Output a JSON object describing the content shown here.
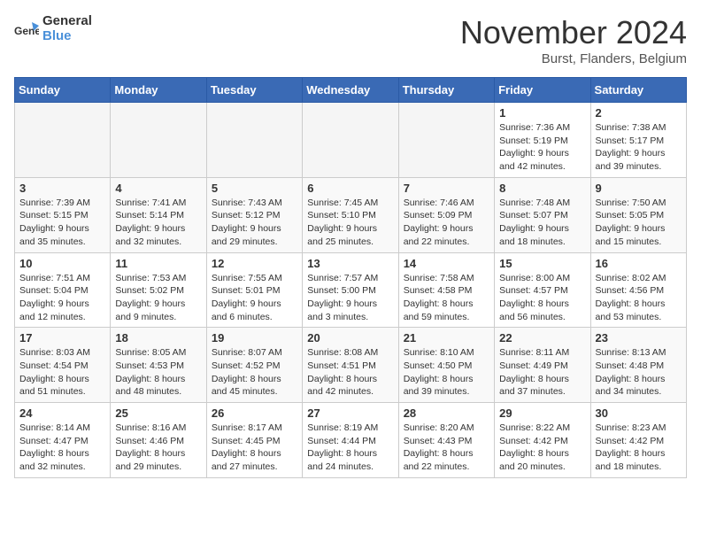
{
  "logo": {
    "line1": "General",
    "line2": "Blue"
  },
  "title": "November 2024",
  "location": "Burst, Flanders, Belgium",
  "days_of_week": [
    "Sunday",
    "Monday",
    "Tuesday",
    "Wednesday",
    "Thursday",
    "Friday",
    "Saturday"
  ],
  "weeks": [
    [
      {
        "day": "",
        "info": ""
      },
      {
        "day": "",
        "info": ""
      },
      {
        "day": "",
        "info": ""
      },
      {
        "day": "",
        "info": ""
      },
      {
        "day": "",
        "info": ""
      },
      {
        "day": "1",
        "info": "Sunrise: 7:36 AM\nSunset: 5:19 PM\nDaylight: 9 hours and 42 minutes."
      },
      {
        "day": "2",
        "info": "Sunrise: 7:38 AM\nSunset: 5:17 PM\nDaylight: 9 hours and 39 minutes."
      }
    ],
    [
      {
        "day": "3",
        "info": "Sunrise: 7:39 AM\nSunset: 5:15 PM\nDaylight: 9 hours and 35 minutes."
      },
      {
        "day": "4",
        "info": "Sunrise: 7:41 AM\nSunset: 5:14 PM\nDaylight: 9 hours and 32 minutes."
      },
      {
        "day": "5",
        "info": "Sunrise: 7:43 AM\nSunset: 5:12 PM\nDaylight: 9 hours and 29 minutes."
      },
      {
        "day": "6",
        "info": "Sunrise: 7:45 AM\nSunset: 5:10 PM\nDaylight: 9 hours and 25 minutes."
      },
      {
        "day": "7",
        "info": "Sunrise: 7:46 AM\nSunset: 5:09 PM\nDaylight: 9 hours and 22 minutes."
      },
      {
        "day": "8",
        "info": "Sunrise: 7:48 AM\nSunset: 5:07 PM\nDaylight: 9 hours and 18 minutes."
      },
      {
        "day": "9",
        "info": "Sunrise: 7:50 AM\nSunset: 5:05 PM\nDaylight: 9 hours and 15 minutes."
      }
    ],
    [
      {
        "day": "10",
        "info": "Sunrise: 7:51 AM\nSunset: 5:04 PM\nDaylight: 9 hours and 12 minutes."
      },
      {
        "day": "11",
        "info": "Sunrise: 7:53 AM\nSunset: 5:02 PM\nDaylight: 9 hours and 9 minutes."
      },
      {
        "day": "12",
        "info": "Sunrise: 7:55 AM\nSunset: 5:01 PM\nDaylight: 9 hours and 6 minutes."
      },
      {
        "day": "13",
        "info": "Sunrise: 7:57 AM\nSunset: 5:00 PM\nDaylight: 9 hours and 3 minutes."
      },
      {
        "day": "14",
        "info": "Sunrise: 7:58 AM\nSunset: 4:58 PM\nDaylight: 8 hours and 59 minutes."
      },
      {
        "day": "15",
        "info": "Sunrise: 8:00 AM\nSunset: 4:57 PM\nDaylight: 8 hours and 56 minutes."
      },
      {
        "day": "16",
        "info": "Sunrise: 8:02 AM\nSunset: 4:56 PM\nDaylight: 8 hours and 53 minutes."
      }
    ],
    [
      {
        "day": "17",
        "info": "Sunrise: 8:03 AM\nSunset: 4:54 PM\nDaylight: 8 hours and 51 minutes."
      },
      {
        "day": "18",
        "info": "Sunrise: 8:05 AM\nSunset: 4:53 PM\nDaylight: 8 hours and 48 minutes."
      },
      {
        "day": "19",
        "info": "Sunrise: 8:07 AM\nSunset: 4:52 PM\nDaylight: 8 hours and 45 minutes."
      },
      {
        "day": "20",
        "info": "Sunrise: 8:08 AM\nSunset: 4:51 PM\nDaylight: 8 hours and 42 minutes."
      },
      {
        "day": "21",
        "info": "Sunrise: 8:10 AM\nSunset: 4:50 PM\nDaylight: 8 hours and 39 minutes."
      },
      {
        "day": "22",
        "info": "Sunrise: 8:11 AM\nSunset: 4:49 PM\nDaylight: 8 hours and 37 minutes."
      },
      {
        "day": "23",
        "info": "Sunrise: 8:13 AM\nSunset: 4:48 PM\nDaylight: 8 hours and 34 minutes."
      }
    ],
    [
      {
        "day": "24",
        "info": "Sunrise: 8:14 AM\nSunset: 4:47 PM\nDaylight: 8 hours and 32 minutes."
      },
      {
        "day": "25",
        "info": "Sunrise: 8:16 AM\nSunset: 4:46 PM\nDaylight: 8 hours and 29 minutes."
      },
      {
        "day": "26",
        "info": "Sunrise: 8:17 AM\nSunset: 4:45 PM\nDaylight: 8 hours and 27 minutes."
      },
      {
        "day": "27",
        "info": "Sunrise: 8:19 AM\nSunset: 4:44 PM\nDaylight: 8 hours and 24 minutes."
      },
      {
        "day": "28",
        "info": "Sunrise: 8:20 AM\nSunset: 4:43 PM\nDaylight: 8 hours and 22 minutes."
      },
      {
        "day": "29",
        "info": "Sunrise: 8:22 AM\nSunset: 4:42 PM\nDaylight: 8 hours and 20 minutes."
      },
      {
        "day": "30",
        "info": "Sunrise: 8:23 AM\nSunset: 4:42 PM\nDaylight: 8 hours and 18 minutes."
      }
    ]
  ]
}
